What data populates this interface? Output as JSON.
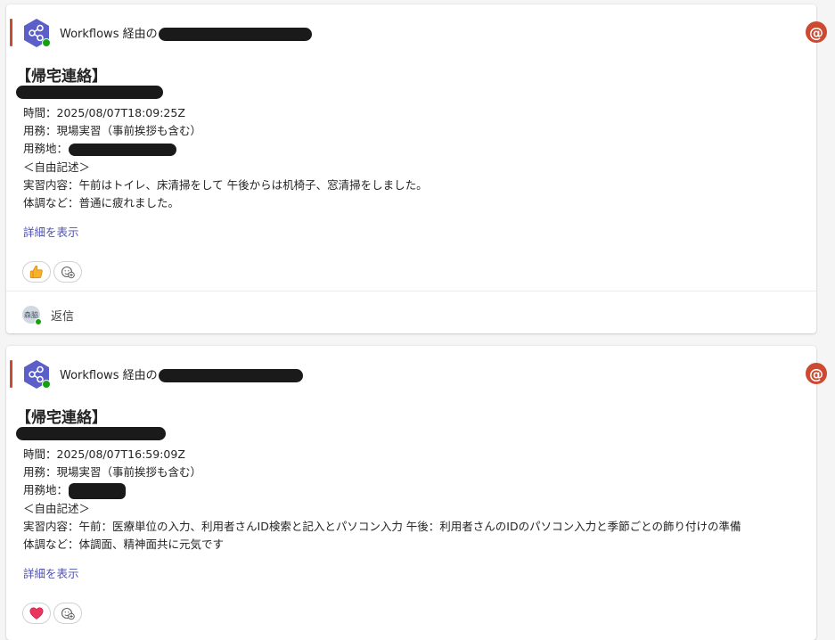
{
  "colors": {
    "accent_bar": "#cc4a31",
    "bot_avatar": "#5b5fc7",
    "presence": "#13a10e",
    "mention": "#cc4a31",
    "link": "#4f52b2"
  },
  "messages": [
    {
      "sender_prefix": "Workflows 経由の",
      "mention_icon": "@",
      "title": "【帰宅連絡】",
      "lines": {
        "time": "時間：2025/08/07T18:09:25Z",
        "task": "用務：現場実習（事前挨拶も含む）",
        "place_label": "用務地：",
        "free_label": "＜自由記述＞",
        "content": "実習内容：午前はトイレ、床清掃をして 午後からは机椅子、窓清掃をしました。",
        "condition": "体調など：普通に疲れました。"
      },
      "detail_link": "詳細を表示",
      "reactions": [
        "thumbs-up",
        "add-reaction"
      ],
      "reply": {
        "avatar_initials": "森脇",
        "label": "返信"
      }
    },
    {
      "sender_prefix": "Workflows 経由の",
      "mention_icon": "@",
      "title": "【帰宅連絡】",
      "lines": {
        "time": "時間：2025/08/07T16:59:09Z",
        "task": "用務：現場実習（事前挨拶も含む）",
        "place_label": "用務地：",
        "free_label": "＜自由記述＞",
        "content": "実習内容：午前：医療単位の入力、利用者さんID検索と記入とパソコン入力 午後：利用者さんのIDのパソコン入力と季節ごとの飾り付けの準備",
        "condition": "体調など：体調面、精神面共に元気です"
      },
      "detail_link": "詳細を表示",
      "reactions": [
        "heart",
        "add-reaction"
      ]
    }
  ]
}
